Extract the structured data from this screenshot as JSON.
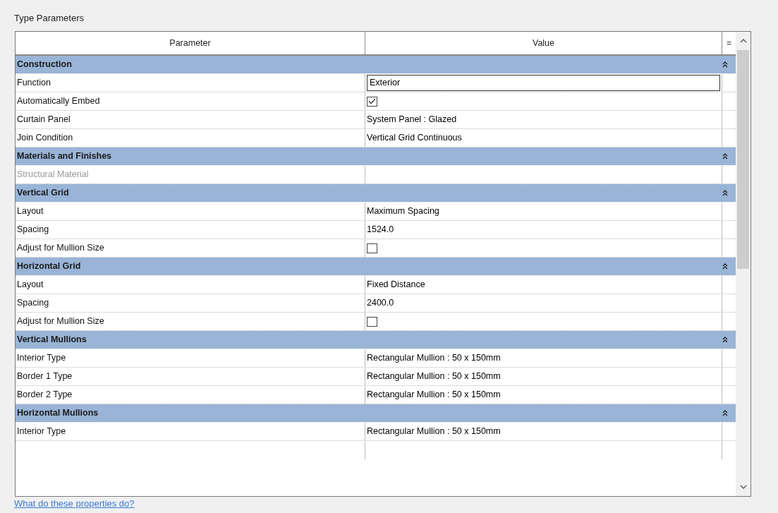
{
  "title": "Type Parameters",
  "columns": [
    "Parameter",
    "Value",
    "="
  ],
  "groups": [
    {
      "name": "Construction",
      "expanded": true,
      "rows": [
        {
          "parameter": "Function",
          "value": "Exterior",
          "kind": "input",
          "disabled": false
        },
        {
          "parameter": "Automatically Embed",
          "checked": true,
          "kind": "check",
          "disabled": false
        },
        {
          "parameter": "Curtain Panel",
          "value": "System Panel : Glazed",
          "kind": "text",
          "disabled": false
        },
        {
          "parameter": "Join Condition",
          "value": "Vertical Grid Continuous",
          "kind": "text",
          "disabled": false
        }
      ]
    },
    {
      "name": "Materials and Finishes",
      "expanded": true,
      "rows": [
        {
          "parameter": "Structural Material",
          "kind": "text",
          "disabled": true
        }
      ]
    },
    {
      "name": "Vertical Grid",
      "expanded": true,
      "rows": [
        {
          "parameter": "Layout",
          "value": "Maximum Spacing",
          "kind": "text",
          "disabled": false
        },
        {
          "parameter": "Spacing",
          "value": "1524.0",
          "kind": "text",
          "disabled": false
        },
        {
          "parameter": "Adjust for Mullion Size",
          "checked": false,
          "kind": "check",
          "disabled": false
        }
      ]
    },
    {
      "name": "Horizontal Grid",
      "expanded": true,
      "rows": [
        {
          "parameter": "Layout",
          "value": "Fixed Distance",
          "kind": "text",
          "disabled": false
        },
        {
          "parameter": "Spacing",
          "value": "2400.0",
          "kind": "text",
          "disabled": false
        },
        {
          "parameter": "Adjust for Mullion Size",
          "checked": false,
          "kind": "check",
          "disabled": false
        }
      ]
    },
    {
      "name": "Vertical Mullions",
      "expanded": true,
      "rows": [
        {
          "parameter": "Interior Type",
          "value": "Rectangular Mullion : 50 x 150mm",
          "kind": "text",
          "disabled": false
        },
        {
          "parameter": "Border 1 Type",
          "value": "Rectangular Mullion : 50 x 150mm",
          "kind": "text",
          "disabled": false
        },
        {
          "parameter": "Border 2 Type",
          "value": "Rectangular Mullion : 50 x 150mm",
          "kind": "text",
          "disabled": false
        }
      ]
    },
    {
      "name": "Horizontal Mullions",
      "expanded": true,
      "rows": [
        {
          "parameter": "Interior Type",
          "value": "Rectangular Mullion : 50 x 150mm",
          "kind": "text",
          "disabled": false
        }
      ]
    }
  ],
  "help_link": "What do these properties do?"
}
